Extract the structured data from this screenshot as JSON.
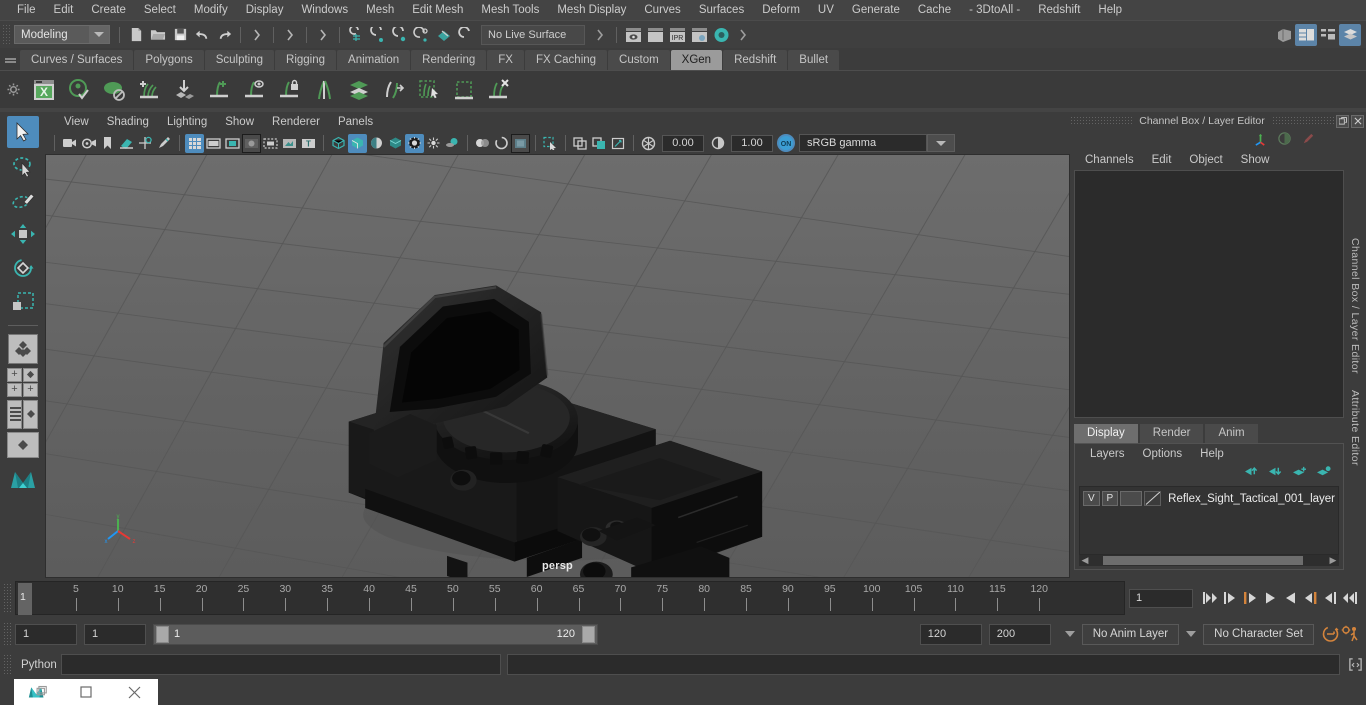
{
  "menubar": {
    "items": [
      "File",
      "Edit",
      "Create",
      "Select",
      "Modify",
      "Display",
      "Windows",
      "Mesh",
      "Edit Mesh",
      "Mesh Tools",
      "Mesh Display",
      "Curves",
      "Surfaces",
      "Deform",
      "UV",
      "Generate",
      "Cache",
      "- 3DtoAll -",
      "Redshift",
      "Help"
    ]
  },
  "statusline": {
    "menuset": "Modeling",
    "live_surface": "No Live Surface",
    "icons": [
      "new-scene-icon",
      "open-scene-icon",
      "save-scene-icon",
      "undo-icon",
      "redo-icon",
      "select-by-hierarchy-icon",
      "select-by-object-icon",
      "select-by-component-icon",
      "snap-to-grid-icon",
      "snap-to-curve-icon",
      "snap-to-point-icon",
      "snap-to-projected-center-icon",
      "snap-to-view-plane-icon",
      "make-live-icon",
      "render-current-frame-icon",
      "ipr-render-icon",
      "render-settings-icon",
      "hypershade-icon"
    ],
    "right_icons": [
      "show-hide-editors-icon",
      "attribute-editor-icon",
      "tool-settings-icon",
      "channel-box-icon"
    ]
  },
  "shelf": {
    "tabs": [
      "Curves / Surfaces",
      "Polygons",
      "Sculpting",
      "Rigging",
      "Animation",
      "Rendering",
      "FX",
      "FX Caching",
      "Custom",
      "XGen",
      "Redshift",
      "Bullet"
    ],
    "active_tab": "XGen",
    "buttons": [
      "xgen-editor-icon",
      "xgen-preview-icon",
      "xgen-render-icon",
      "xgen-add-description-icon",
      "xgen-import-icon",
      "xgen-grow-icon",
      "xgen-visibility-icon",
      "xgen-lock-icon",
      "xgen-split-icon",
      "xgen-layer-icon",
      "xgen-groom-icon",
      "xgen-select-region-icon",
      "xgen-clump-icon",
      "xgen-delete-icon"
    ]
  },
  "toolbox": {
    "tools": [
      {
        "name": "select-tool",
        "selected": true
      },
      {
        "name": "lasso-select-tool",
        "selected": false
      },
      {
        "name": "paint-select-tool",
        "selected": false
      },
      {
        "name": "move-tool",
        "selected": false
      },
      {
        "name": "rotate-tool",
        "selected": false
      },
      {
        "name": "scale-tool",
        "selected": false
      },
      {
        "name": "last-tool-used",
        "selected": false
      },
      {
        "name": "single-perspective-layout",
        "selected": false
      },
      {
        "name": "four-view-layout",
        "selected": false
      },
      {
        "name": "outliner-persp-layout",
        "selected": false
      },
      {
        "name": "hypergraph-persp-layout",
        "selected": false
      },
      {
        "name": "maya-logo",
        "selected": false
      }
    ]
  },
  "viewport": {
    "panel_menu": [
      "View",
      "Shading",
      "Lighting",
      "Show",
      "Renderer",
      "Panels"
    ],
    "camera_label": "persp",
    "exposure": "0.00",
    "gamma": "1.00",
    "color_space": "sRGB gamma",
    "toolbar_icons": [
      "select-camera-icon",
      "camera-attributes-icon",
      "bookmark-icon",
      "image-plane-icon",
      "two-d-pan-zoom-icon",
      "grease-pencil-icon",
      "grid-toggle-icon",
      "film-gate-icon",
      "resolution-gate-icon",
      "gate-mask-icon",
      "film-origin-icon",
      "safe-action-icon",
      "camera-names-icon",
      "wireframe-icon",
      "smooth-shade-icon",
      "shaded-wireframe-icon",
      "textured-icon",
      "use-all-lights-icon",
      "shadows-icon",
      "ambient-occlusion-icon",
      "motion-blur-icon",
      "multisample-icon",
      "depth-of-field-icon",
      "isolate-select-icon",
      "xray-icon",
      "xray-joints-icon",
      "panel-zoom-icon",
      "view-transform-icon",
      "exposure-icon",
      "gamma-icon",
      "color-management-icon"
    ]
  },
  "channel_box": {
    "title": "Channel Box / Layer Editor",
    "menu": [
      "Channels",
      "Edit",
      "Object",
      "Show"
    ],
    "header_icons": [
      "axis-orient-icon",
      "shading-sphere-icon",
      "pencil-icon"
    ],
    "window_buttons": [
      "undock-icon",
      "close-icon"
    ]
  },
  "layer_editor": {
    "tabs": [
      "Display",
      "Render",
      "Anim"
    ],
    "active_tab": "Display",
    "menu": [
      "Layers",
      "Options",
      "Help"
    ],
    "buttons": [
      "move-layer-up-icon",
      "move-layer-down-icon",
      "create-empty-layer-icon",
      "create-layer-from-selected-icon"
    ],
    "layers": [
      {
        "visibility": "V",
        "playback": "P",
        "color": "",
        "name": "Reflex_Sight_Tactical_001_layer"
      }
    ]
  },
  "side_tabs": [
    "Channel Box / Layer Editor",
    "Attribute Editor"
  ],
  "timeline": {
    "ticks": [
      5,
      10,
      15,
      20,
      25,
      30,
      35,
      40,
      45,
      50,
      55,
      60,
      65,
      70,
      75,
      80,
      85,
      90,
      95,
      100,
      105,
      110,
      115,
      120
    ],
    "current_frame": "1",
    "frame_field": "1",
    "playback_buttons": [
      "go-to-start-icon",
      "step-back-keyframe-icon",
      "step-back-frame-icon",
      "play-backwards-icon",
      "play-forwards-icon",
      "step-forward-frame-icon",
      "step-forward-keyframe-icon",
      "go-to-end-icon"
    ]
  },
  "range": {
    "anim_start": "1",
    "range_start": "1",
    "slider_min": "1",
    "slider_max": "120",
    "range_end": "120",
    "anim_end": "200",
    "anim_layer": "No Anim Layer",
    "character_set": "No Character Set",
    "right_icons": [
      "auto-key-icon",
      "animation-preferences-icon"
    ]
  },
  "command_line": {
    "language": "Python",
    "input_value": "",
    "output_value": "",
    "icon": "script-editor-icon"
  },
  "taskbar": {
    "items": [
      "maya-app-icon",
      "restore-window-icon",
      "close-window-icon"
    ]
  },
  "colors": {
    "accent_blue": "#4e8cbd",
    "accent_teal": "#3ab5b0",
    "accent_orange": "#d4843c",
    "panel_bg": "#3c3c3c",
    "viewport_bg": "#636363",
    "field_bg": "#2b2b2b"
  }
}
